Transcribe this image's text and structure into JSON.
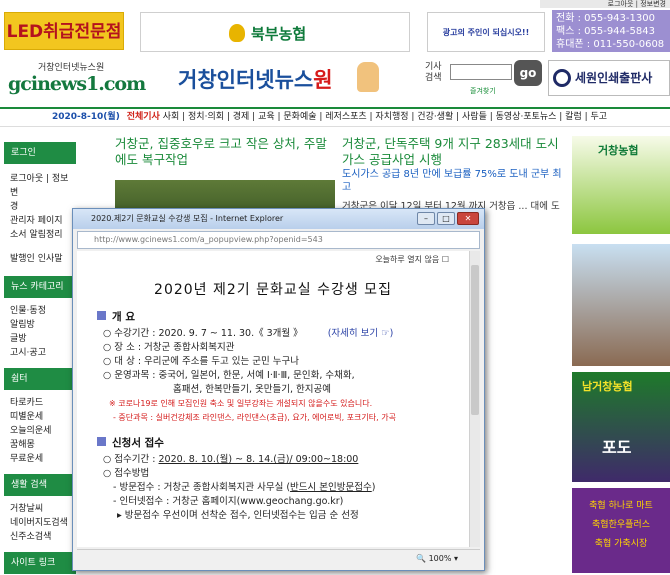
{
  "top": {
    "links": "로그아웃 | 정보변경"
  },
  "banners": {
    "led": "LED취급전문점",
    "nh": "북부농협",
    "ad": "광고의 주인이 되십시오!!",
    "contact": [
      "전화 : 055-943-1300",
      "팩스 : 055-944-5843",
      "휴대폰 : 011-550-0608"
    ],
    "print": "세원인쇄출판사"
  },
  "logo": {
    "small": "거창인터넷뉴스원",
    "big": "gcinews1.com",
    "main": "거창인터넷뉴스",
    "main_accent": "원"
  },
  "search": {
    "label1": "기사",
    "label2": "검색",
    "go": "go",
    "fav": "즐겨찾기"
  },
  "nav": {
    "date": "2020-8-10(월)",
    "highlight": "전체기사",
    "items": "사회 | 정치·의회 | 경제 | 교육 | 문화예술 | 레저스포츠 | 자치행정 | 건강·생활 | 사람들 | 동영상·포토뉴스 | 칼럼 | 두고"
  },
  "sidebar": [
    {
      "head": "로그인",
      "items": [
        "로그아웃 | 정보변",
        "경",
        "관리자 페이지",
        "소서 알림정리",
        "",
        "발행인 인사말"
      ]
    },
    {
      "head": "뉴스 카테고리",
      "items": [
        "인물·동정",
        "알림방",
        "글방",
        "고시·공고"
      ]
    },
    {
      "head": "쉼터",
      "items": [
        "타로카드",
        "띠별운세",
        "오늘의운세",
        "꿈해몽",
        "무료운세"
      ]
    },
    {
      "head": "생활 검색",
      "items": [
        "거창날씨",
        "네이버지도검색",
        "신주소검색"
      ]
    },
    {
      "head": "사이트 링크",
      "items": []
    }
  ],
  "articles": {
    "a1": "거창군, 집중호우로 크고 작은 상처, 주말에도 복구작업",
    "a2": "거창군, 단독주택 9개 지구 283세대 도시가스 공급사업 시행",
    "a2_sub": "도시가스 공급 8년 만에 보급률 75%로 도내 군부 최고",
    "a2_body": "거창군은 이달 12일 부터 12월 까지 거창읍 ... 대에 도시가 실시한다. 올 배설사업은"
  },
  "right": {
    "nh": "거창농협",
    "nh2": "남거창농협",
    "grape": "포도",
    "tag1": "축협 하나로 마트",
    "tag2": "축협한우플러스",
    "tag3": "축협 가축시장"
  },
  "popup": {
    "window_title": "2020.제2기 문화교실 수강생 모집 - Internet Explorer",
    "url": "http://www.gcinews1.com/a_popupview.php?openid=543",
    "notice": "오늘하루 열지 않음",
    "title": "2020년 제2기 문화교실 수강생 모집",
    "sec1": "개    요",
    "period_label": "○ 수강기간 : ",
    "period": "2020. 9. 7 ~ 11. 30.《 3개월 》",
    "more": "(자세히 보기 ☞)",
    "place": "○ 장    소 : 거창군 종합사회복지관",
    "target": "○ 대    상 : 우리군에 주소를 두고 있는 군민 누구나",
    "courses1": "○ 운영과목 : 중국어, 일본어, 한문, 서예 Ⅰ·Ⅱ·Ⅲ, 문인화, 수채화,",
    "courses2": "홈패션, 한복만들기, 옷만들기, 한지공예",
    "covid": "※ 코로나19로 인해 모집인원 축소 및 일부강좌는 개설되지 않을수도 있습니다.",
    "suspended": "- 중단과목 : 실버건강체조 라인댄스, 라인댄스(초급), 요가, 에어로빅, 포크기타, 가곡",
    "sec2": "신청서 접수",
    "receipt_label": "○ 접수기간 : ",
    "receipt": "2020. 8. 10.(월) ~ 8. 14.(금)/ 09:00~18:00",
    "method": "○ 접수방법",
    "visit_label": "- 방문접수 : 거창군 종합사회복지관 사무실 (",
    "visit_em": "반드시 본인방문접수",
    "visit_end": ")",
    "online": "- 인터넷접수 : 거창군 홈페이지(www.geochang.go.kr)",
    "priority": "▸ 방문접수 우선이며 선착순 접수, 인터넷접수는 입금 순 선정",
    "zoom": "100%"
  }
}
